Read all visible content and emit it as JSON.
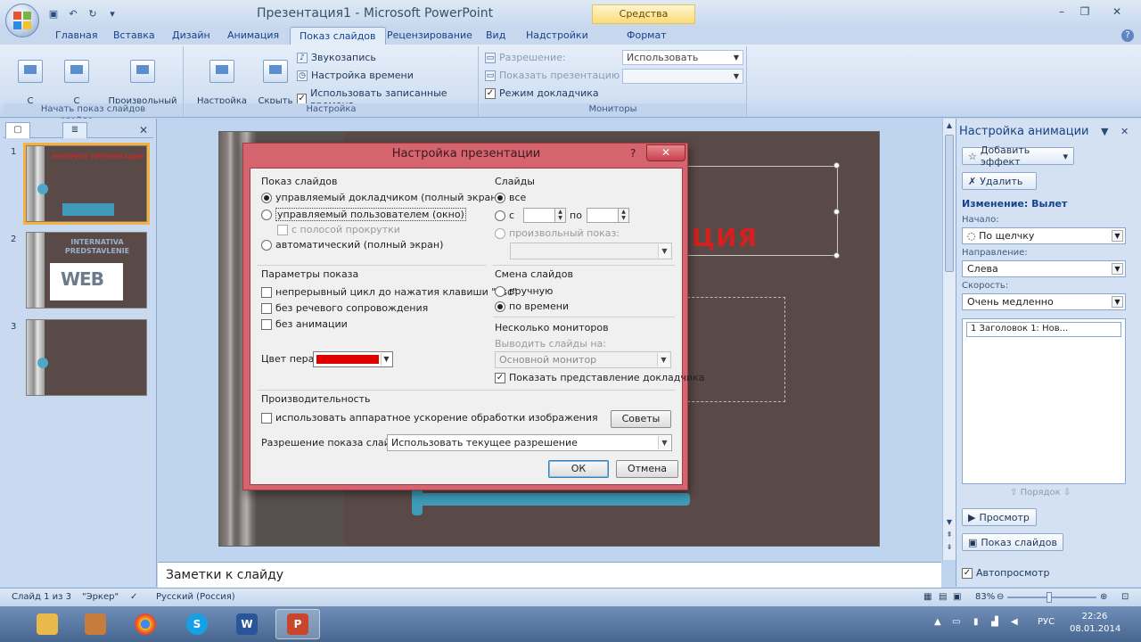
{
  "window": {
    "title": "Презентация1 - Microsoft PowerPoint",
    "context_tab": "Средства рисования"
  },
  "ribbon_tabs": [
    {
      "label": "Главная"
    },
    {
      "label": "Вставка"
    },
    {
      "label": "Дизайн"
    },
    {
      "label": "Анимация"
    },
    {
      "label": "Показ слайдов"
    },
    {
      "label": "Рецензирование"
    },
    {
      "label": "Вид"
    },
    {
      "label": "Надстройки"
    },
    {
      "label": "Формат"
    }
  ],
  "ribbon": {
    "group_start": {
      "label": "Начать показ слайдов",
      "btn_from_start": "С\nначала",
      "btn_from_current": "С текущего\nслайда",
      "btn_custom": "Произвольный\nпоказ ▾"
    },
    "group_setup": {
      "label": "Настройка",
      "btn_setup": "Настройка\nдемонстрации",
      "btn_hide": "Скрыть\nслайд",
      "record_narration": "Звукозапись",
      "rehearse": "Настройка времени",
      "use_timings": "Использовать записанные времена"
    },
    "group_monitors": {
      "label": "Мониторы",
      "resolution_label": "Разрешение:",
      "resolution_value": "Использовать текуще...",
      "show_on_label": "Показать презентацию на:",
      "presenter_view": "Режим докладчика"
    }
  },
  "slides_panel": {
    "tab_slides": "▢",
    "tab_outline": "≣",
    "close": "✕",
    "slides": [
      {
        "num": "1",
        "title": "ИНТЕРНЕТ ПРЕЗЕНТАЦИЯ"
      },
      {
        "num": "2",
        "title": "INTERNATIVA\nPREDSTAVLENIE",
        "web": "WEB"
      },
      {
        "num": "3"
      }
    ]
  },
  "main_slide": {
    "title_fragment": "ЦИЯ"
  },
  "notes": {
    "placeholder": "Заметки к слайду"
  },
  "anim_pane": {
    "title": "Настройка анимации",
    "add_effect": "Добавить эффект",
    "remove": "Удалить",
    "change_label": "Изменение: Вылет",
    "start_label": "Начало:",
    "start_value": "По щелчку",
    "direction_label": "Направление:",
    "direction_value": "Слева",
    "speed_label": "Скорость:",
    "speed_value": "Очень медленно",
    "list_item": "1      Заголовок 1: Нов...",
    "order": "Порядок",
    "play": "Просмотр",
    "slideshow": "Показ слайдов",
    "autopreview": "Автопросмотр"
  },
  "status": {
    "slide": "Слайд 1 из 3",
    "theme": "\"Эркер\"",
    "lang": "Русский (Россия)",
    "zoom": "83%"
  },
  "taskbar": {
    "lang": "РУС",
    "time": "22:26",
    "date": "08.01.2014"
  },
  "dialog": {
    "title": "Настройка презентации",
    "help": "?",
    "close": "✕",
    "show_type": {
      "label": "Показ слайдов",
      "opt_speaker": "управляемый докладчиком (полный экран)",
      "opt_individual": "управляемый пользователем (окно)",
      "opt_scrollbar": "с полосой прокрутки",
      "opt_kiosk": "автоматический (полный экран)"
    },
    "slides": {
      "label": "Слайды",
      "opt_all": "все",
      "opt_from": "с",
      "to": "по",
      "opt_custom": "произвольный показ:"
    },
    "show_options": {
      "label": "Параметры показа",
      "loop": "непрерывный цикл до нажатия клавиши \"Esc\"",
      "no_narration": "без речевого сопровождения",
      "no_animation": "без анимации",
      "pen_color": "Цвет пера:"
    },
    "advance": {
      "label": "Смена слайдов",
      "manual": "вручную",
      "timings": "по времени"
    },
    "monitors": {
      "label": "Несколько мониторов",
      "display_on": "Выводить слайды на:",
      "display_value": "Основной монитор",
      "presenter_view": "Показать представление докладчика"
    },
    "performance": {
      "label": "Производительность",
      "hw_accel": "использовать аппаратное ускорение обработки изображения",
      "tips": "Советы",
      "resolution_label": "Разрешение показа слайдов:",
      "resolution_value": "Использовать текущее разрешение"
    },
    "ok": "ОК",
    "cancel": "Отмена"
  },
  "colors": {
    "dialog_frame": "#d6646e",
    "slide_bg": "#5a4a47",
    "accent_teal": "#3f9bb9",
    "pen_red": "#e00000"
  }
}
